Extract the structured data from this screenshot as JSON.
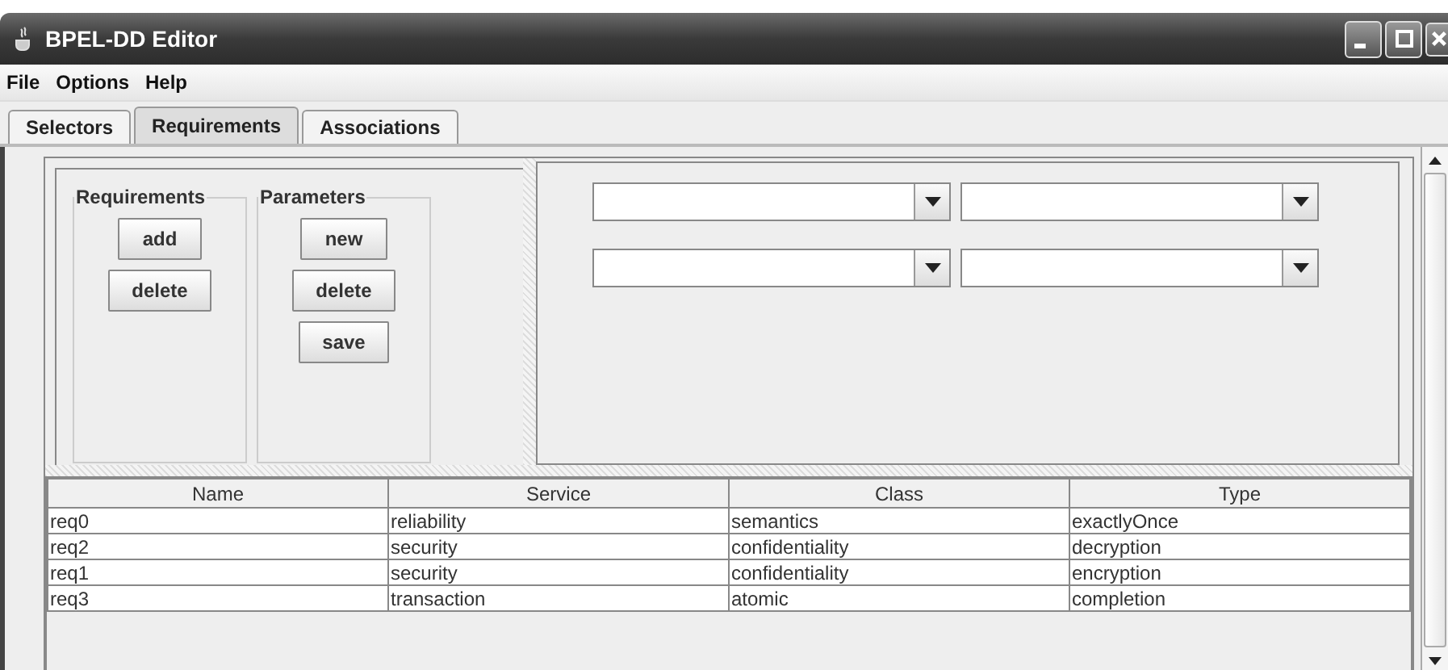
{
  "window": {
    "title": "BPEL-DD Editor"
  },
  "menu": [
    "File",
    "Options",
    "Help"
  ],
  "tabs": [
    {
      "label": "Selectors",
      "selected": false
    },
    {
      "label": "Requirements",
      "selected": true
    },
    {
      "label": "Associations",
      "selected": false
    }
  ],
  "groups": [
    {
      "title": "Requirements",
      "buttons": [
        "add",
        "delete"
      ]
    },
    {
      "title": "Parameters",
      "buttons": [
        "new",
        "delete",
        "save"
      ]
    }
  ],
  "table": {
    "columns": [
      "Name",
      "Service",
      "Class",
      "Type"
    ],
    "rows": [
      [
        "req0",
        "reliability",
        "semantics",
        "exactlyOnce"
      ],
      [
        "req2",
        "security",
        "confidentiality",
        "decryption"
      ],
      [
        "req1",
        "security",
        "confidentiality",
        "encryption"
      ],
      [
        "req3",
        "transaction",
        "atomic",
        "completion"
      ]
    ]
  }
}
